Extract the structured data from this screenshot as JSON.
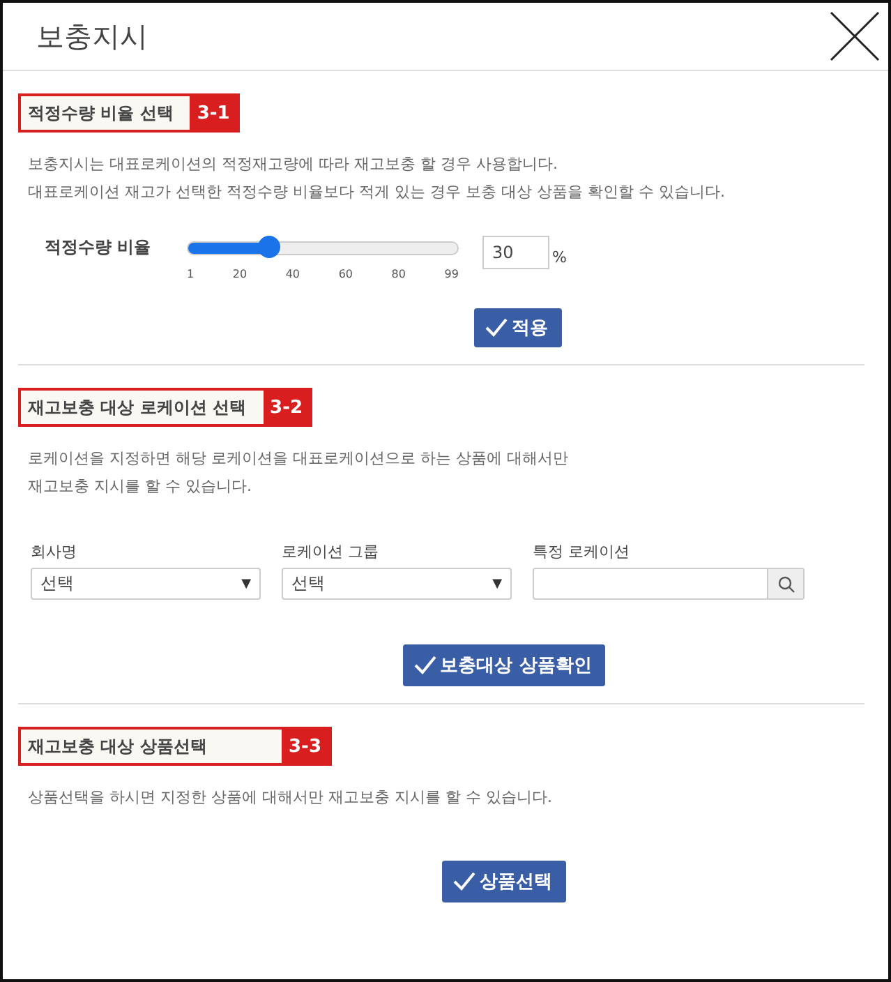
{
  "window": {
    "title": "보충지시"
  },
  "sections": [
    {
      "kind": "ratio",
      "heading": "적정수량 비율 선택",
      "badge": "3-1",
      "description": [
        "보충지시는 대표로케이션의 적정재고량에 따라 재고보충 할 경우 사용합니다.",
        "대표로케이션 재고가 선택한 적정수량 비율보다 적게 있는 경우 보충 대상 상품을 확인할 수 있습니다."
      ],
      "slider": {
        "label": "적정수량 비율",
        "level": 0.3,
        "ticks": [
          "1",
          "20",
          "40",
          "60",
          "80",
          "99"
        ],
        "value": "30",
        "unit": "%"
      },
      "button": "적용"
    },
    {
      "kind": "location",
      "heading": "재고보충 대상 로케이션 선택",
      "badge": "3-2",
      "description": [
        "로케이션을 지정하면 해당 로케이션을 대표로케이션으로 하는 상품에 대해서만",
        "재고보충 지시를 할 수 있습니다."
      ],
      "fields": [
        {
          "kind": "select",
          "label": "회사명",
          "value": "선택",
          "arrow": "▼"
        },
        {
          "kind": "select",
          "label": "로케이션 그룹",
          "value": "선택",
          "arrow": "▼"
        },
        {
          "kind": "search",
          "label": "특정 로케이션"
        }
      ],
      "button": "보충대상 상품확인"
    },
    {
      "kind": "product",
      "heading": "재고보충 대상 상품선택",
      "badge": "3-3",
      "description": [
        "상품선택을 하시면 지정한 상품에 대해서만 재고보충 지시를 할 수 있습니다."
      ],
      "button": "상품선택"
    }
  ]
}
